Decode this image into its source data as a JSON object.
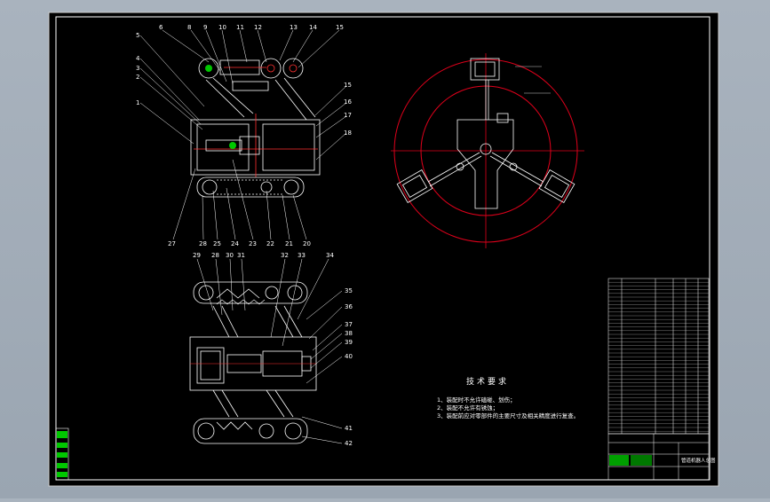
{
  "colors": {
    "background": "#a4aeb9",
    "sheet": "#000000",
    "line": "#ffffff",
    "circle": "#e0001b",
    "accent": "#00c800"
  },
  "balloons_top": [
    "6",
    "8",
    "9",
    "10",
    "11",
    "12",
    "13",
    "14",
    "15"
  ],
  "balloons_left_top": [
    "5",
    "4",
    "3",
    "2",
    "1"
  ],
  "balloons_right_top": [
    "15",
    "16",
    "17",
    "18"
  ],
  "balloons_bottom_top": [
    "27",
    "28",
    "25",
    "24",
    "23",
    "22",
    "21",
    "20"
  ],
  "balloons_top2": [
    "29",
    "28",
    "30",
    "31",
    "32",
    "33",
    "34"
  ],
  "balloons_right_bottom": [
    "35",
    "36",
    "37",
    "38",
    "39",
    "40",
    "41",
    "42"
  ],
  "technical_requirements": {
    "title": "技术要求",
    "items": [
      "1、装配时不允许磕碰、划伤；",
      "2、装配不允许有锈蚀；",
      "3、装配前应对零部件的主要尺寸及相关精度进行复查。"
    ]
  },
  "title_block": {
    "name": "管道机器人总图"
  }
}
